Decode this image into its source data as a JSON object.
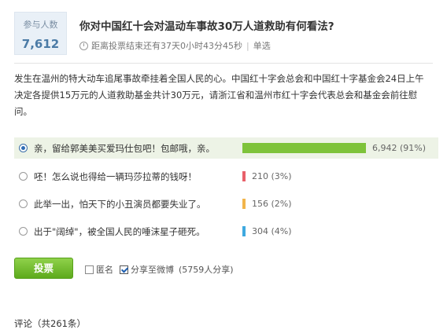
{
  "participants": {
    "label": "参与人数",
    "count": "7,612"
  },
  "poll": {
    "title": "你对中国红十会对温动车事故30万人道救助有何看法?",
    "countdown": "距离投票结束还有37天0小时43分45秒",
    "separator": "|",
    "mode": "单选",
    "description": "发生在温州的特大动车追尾事故牵挂着全国人民的心。中国红十字会总会和中国红十字基金会24日上午决定各提供15万元的人道救助基金共计30万元，请浙江省和温州市红十字会代表总会和基金会前往慰问。"
  },
  "options": [
    {
      "label": "亲，留给郭美美买爱玛仕包吧！包邮哦，亲。",
      "votes": "6,942",
      "percent": "(91%)",
      "share": 0.91,
      "color": "#7ec33a",
      "selected": true
    },
    {
      "label": "呸！怎么说也得给一辆玛莎拉蒂的钱呀！",
      "votes": "210",
      "percent": "(3%)",
      "share": 0.03,
      "color": "#e8606a",
      "selected": false
    },
    {
      "label": "此举一出，怕天下的小丑演员都要失业了。",
      "votes": "156",
      "percent": "(2%)",
      "share": 0.02,
      "color": "#f2b54b",
      "selected": false
    },
    {
      "label": "出于\"阔绰\"，被全国人民的唾沫星子砸死。",
      "votes": "304",
      "percent": "(4%)",
      "share": 0.04,
      "color": "#3fa9e0",
      "selected": false
    }
  ],
  "actions": {
    "vote_label": "投票",
    "anonymous_label": "匿名",
    "anonymous_checked": false,
    "share_label": "分享至微博",
    "share_checked": true,
    "share_count": "(5759人分享)"
  },
  "comments": {
    "label": "评论（共261条）"
  }
}
